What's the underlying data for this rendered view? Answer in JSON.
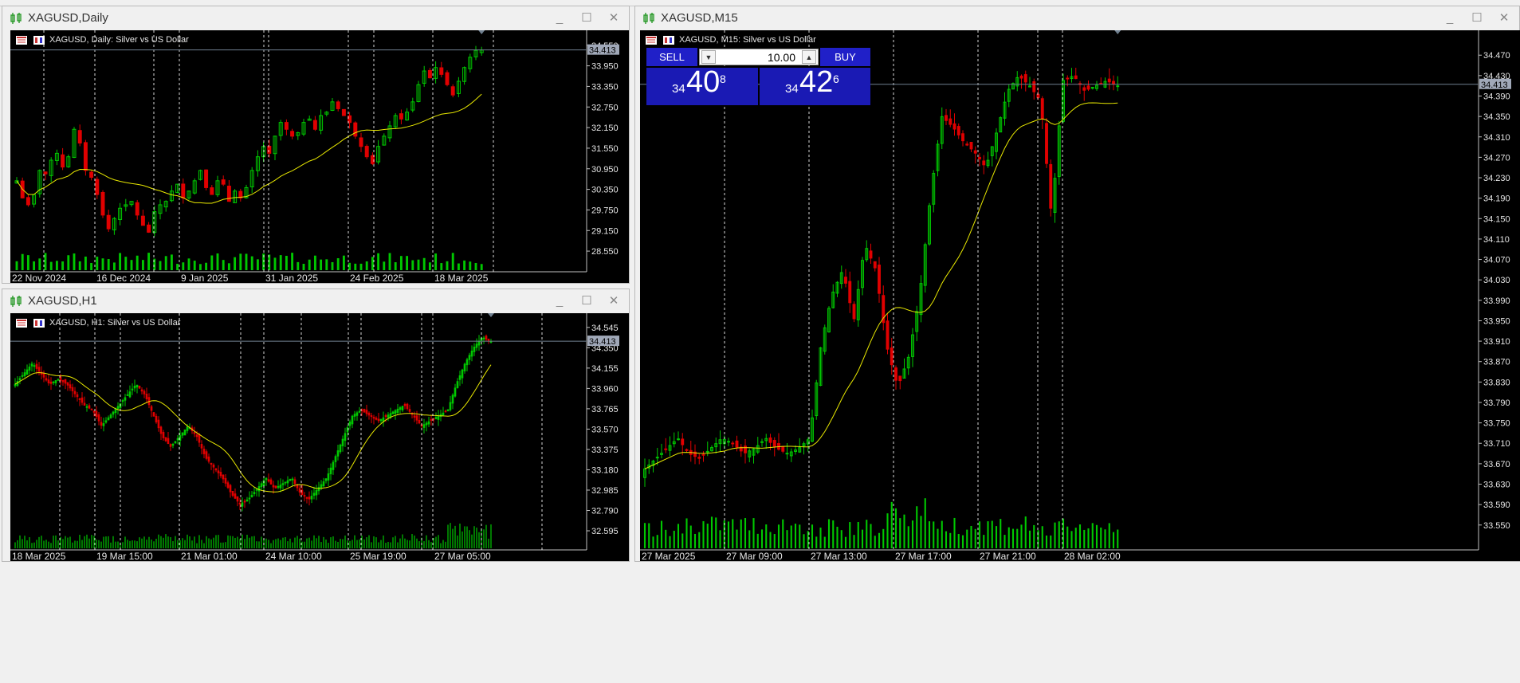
{
  "windows": {
    "daily": {
      "title": "XAGUSD,Daily",
      "label": "XAGUSD, Daily:  Silver vs US Dollar",
      "current_price": "34.413"
    },
    "h1": {
      "title": "XAGUSD,H1",
      "label": "XAGUSD, H1:  Silver vs US Dollar",
      "current_price": "34.413"
    },
    "m15": {
      "title": "XAGUSD,M15",
      "label": "XAGUSD, M15:  Silver vs US Dollar",
      "current_price": "34.413"
    }
  },
  "window_controls": {
    "minimize": "_",
    "maximize": "☐",
    "close": "✕"
  },
  "trade_panel": {
    "sell_label": "SELL",
    "buy_label": "BUY",
    "lot": "10.00",
    "sell_price": {
      "prefix": "34",
      "big": "40",
      "sup": "8"
    },
    "buy_price": {
      "prefix": "34",
      "big": "42",
      "sup": "6"
    }
  },
  "colors": {
    "background": "#000000",
    "bull": "#00c800",
    "bear": "#e00000",
    "ma": "#e8e800",
    "volume": "#00c800",
    "price_line": "#708090",
    "text": "#e6e6e6"
  },
  "chart_data": [
    {
      "type": "candlestick",
      "name": "daily",
      "ma_period": "moving average",
      "ylim": [
        28.25,
        34.8
      ],
      "y_ticks": [
        "34.550",
        "33.950",
        "33.350",
        "32.750",
        "32.150",
        "31.550",
        "30.950",
        "30.350",
        "29.750",
        "29.150",
        "28.550"
      ],
      "x_ticks": [
        "22 Nov 2024",
        "16 Dec 2024",
        "9 Jan 2025",
        "31 Jan 2025",
        "24 Feb 2025",
        "18 Mar 2025"
      ],
      "close": [
        30.6,
        30.1,
        29.9,
        30.2,
        30.9,
        30.8,
        31.2,
        31.4,
        31.0,
        31.3,
        32.1,
        31.7,
        30.9,
        30.7,
        30.2,
        29.6,
        29.2,
        29.5,
        29.8,
        29.9,
        30.0,
        29.6,
        29.3,
        29.1,
        29.7,
        29.9,
        30.0,
        30.3,
        30.5,
        30.1,
        30.3,
        30.6,
        30.9,
        30.4,
        30.2,
        30.6,
        30.5,
        30.0,
        30.3,
        30.1,
        30.4,
        30.9,
        31.3,
        31.6,
        31.4,
        31.9,
        32.3,
        32.1,
        31.9,
        32.0,
        32.3,
        32.4,
        32.1,
        32.5,
        32.6,
        32.9,
        32.7,
        32.5,
        32.3,
        31.9,
        31.6,
        31.3,
        31.1,
        31.6,
        31.9,
        32.2,
        32.5,
        32.4,
        32.6,
        32.9,
        33.4,
        33.8,
        33.6,
        33.9,
        33.7,
        33.4,
        33.1,
        33.5,
        33.9,
        34.2,
        34.4,
        34.41
      ],
      "volume_relative": "bars along the bottom"
    },
    {
      "type": "candlestick",
      "name": "h1",
      "ylim": [
        32.45,
        34.62
      ],
      "y_ticks": [
        "34.545",
        "34.350",
        "34.155",
        "33.960",
        "33.765",
        "33.570",
        "33.375",
        "33.180",
        "32.985",
        "32.790",
        "32.595"
      ],
      "x_ticks": [
        "18 Mar 2025",
        "19 Mar 15:00",
        "21 Mar 01:00",
        "24 Mar 10:00",
        "25 Mar 19:00",
        "27 Mar 05:00"
      ],
      "close_path": [
        34.0,
        34.1,
        34.2,
        34.1,
        34.0,
        34.05,
        34.0,
        33.9,
        33.8,
        33.75,
        33.6,
        33.7,
        33.8,
        33.9,
        34.0,
        33.9,
        33.7,
        33.5,
        33.4,
        33.5,
        33.6,
        33.5,
        33.3,
        33.2,
        33.1,
        32.95,
        32.85,
        32.9,
        33.0,
        33.1,
        33.0,
        33.05,
        33.1,
        32.95,
        32.9,
        33.0,
        33.1,
        33.3,
        33.5,
        33.7,
        33.75,
        33.7,
        33.65,
        33.7,
        33.75,
        33.8,
        33.7,
        33.6,
        33.65,
        33.7,
        33.75,
        34.0,
        34.2,
        34.35,
        34.45,
        34.41
      ]
    },
    {
      "type": "candlestick",
      "name": "m15",
      "ylim": [
        33.52,
        34.5
      ],
      "y_ticks": [
        "34.470",
        "34.430",
        "34.390",
        "34.350",
        "34.310",
        "34.270",
        "34.230",
        "34.190",
        "34.150",
        "34.110",
        "34.070",
        "34.030",
        "33.990",
        "33.950",
        "33.910",
        "33.870",
        "33.830",
        "33.790",
        "33.750",
        "33.710",
        "33.670",
        "33.630",
        "33.590",
        "33.550"
      ],
      "x_ticks": [
        "27 Mar 2025",
        "27 Mar 09:00",
        "27 Mar 13:00",
        "27 Mar 17:00",
        "27 Mar 21:00",
        "28 Mar 02:00"
      ],
      "close_path": [
        33.66,
        33.68,
        33.7,
        33.72,
        33.69,
        33.68,
        33.7,
        33.72,
        33.71,
        33.69,
        33.7,
        33.72,
        33.7,
        33.69,
        33.7,
        33.72,
        33.9,
        34.0,
        34.05,
        33.95,
        34.1,
        34.05,
        33.9,
        33.82,
        33.88,
        34.0,
        34.2,
        34.35,
        34.33,
        34.3,
        34.28,
        34.25,
        34.32,
        34.4,
        34.43,
        34.41,
        34.38,
        34.15,
        34.42,
        34.43,
        34.4,
        34.41,
        34.42,
        34.41
      ]
    }
  ]
}
